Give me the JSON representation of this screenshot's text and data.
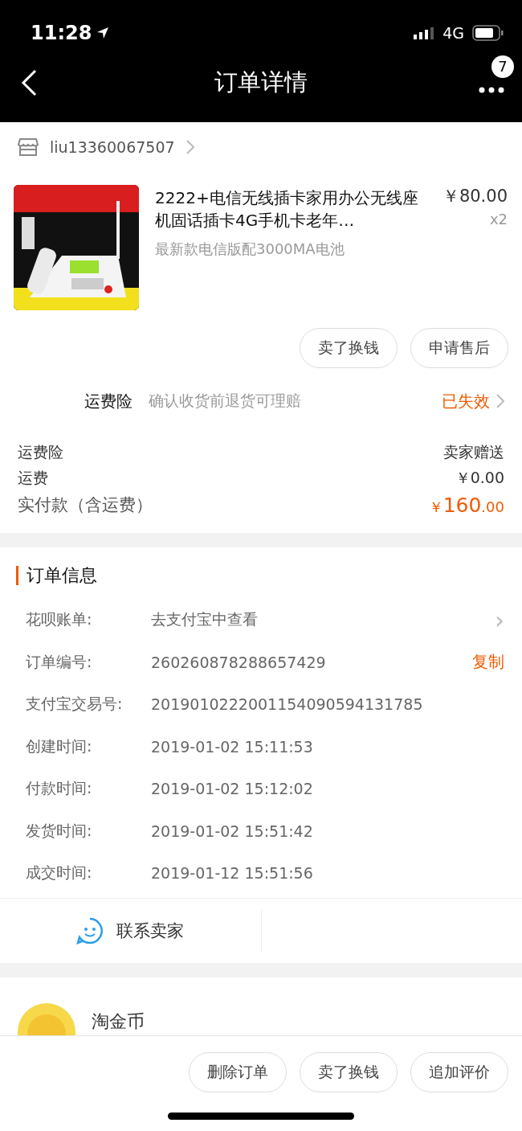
{
  "status_bar": {
    "time": "11:28",
    "network": "4G"
  },
  "nav": {
    "title": "订单详情",
    "badge": "7"
  },
  "shop": {
    "name": "liu13360067507"
  },
  "product": {
    "kind": "picture",
    "title": "2222+电信无线插卡家用办公无线座机固话插卡4G手机卡老年…",
    "sku": "最新款电信版配3000MA电池",
    "price": "￥80.00",
    "quantity": "x2"
  },
  "item_buttons": [
    "卖了换钱",
    "申请售后"
  ],
  "insurance": {
    "label": "运费险",
    "desc": "确认收货前退货可理赔",
    "status": "已失效"
  },
  "costs": [
    {
      "label": "运费险",
      "value": "卖家赠送"
    },
    {
      "label": "运费",
      "value": "￥0.00"
    }
  ],
  "total": {
    "label": "实付款（含运费）",
    "currency": "￥",
    "integer": "160",
    "decimal": ".00"
  },
  "order_info": {
    "title": "订单信息",
    "rows": [
      {
        "label": "花呗账单:",
        "value": "去支付宝中查看",
        "action": "›",
        "kind": "link"
      },
      {
        "label": "订单编号:",
        "value": "260260878288657429",
        "action": "复制",
        "kind": "copy"
      },
      {
        "label": "支付宝交易号:",
        "value": "2019010222001154090594131785",
        "kind": "plain"
      },
      {
        "label": "创建时间:",
        "value": "2019-01-02 15:11:53",
        "kind": "plain"
      },
      {
        "label": "付款时间:",
        "value": "2019-01-02 15:12:02",
        "kind": "plain"
      },
      {
        "label": "发货时间:",
        "value": "2019-01-02 15:51:42",
        "kind": "plain"
      },
      {
        "label": "成交时间:",
        "value": "2019-01-12 15:51:56",
        "kind": "plain"
      }
    ]
  },
  "contact": {
    "label": "联系卖家"
  },
  "coins": {
    "label": "淘金币"
  },
  "bottom_buttons": [
    "删除订单",
    "卖了换钱",
    "追加评价"
  ]
}
